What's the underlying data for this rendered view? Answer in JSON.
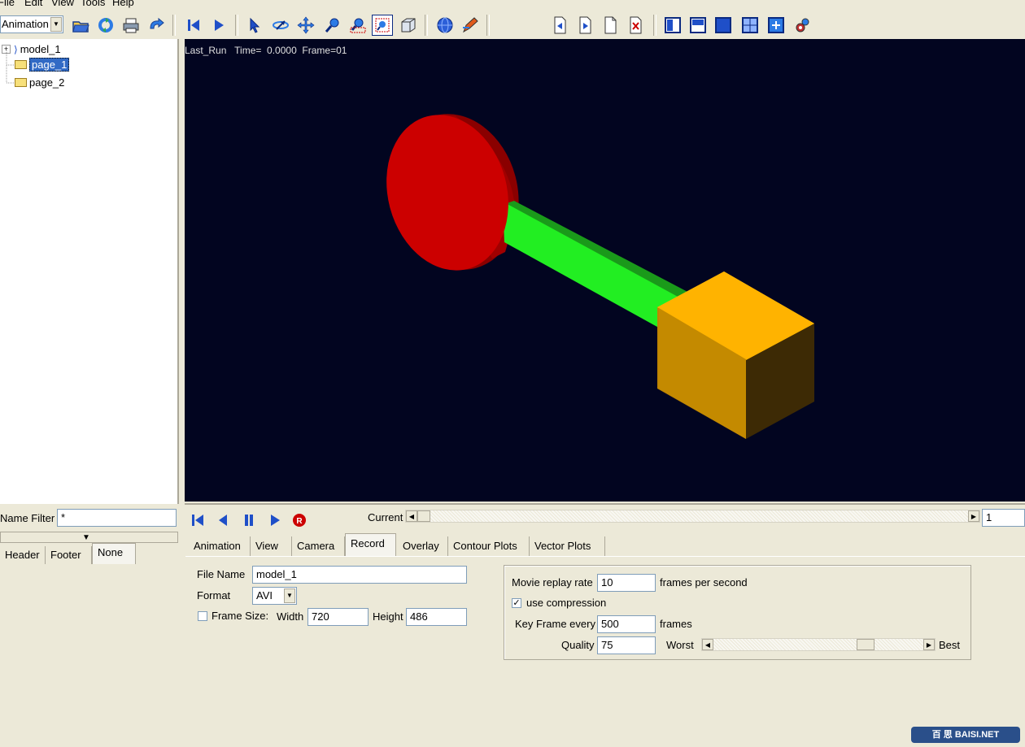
{
  "menu": {
    "items": [
      "File",
      "Edit",
      "View",
      "Tools",
      "Help"
    ]
  },
  "toolbar": {
    "mode": "Animation",
    "icons": [
      "open-folder",
      "reload",
      "print",
      "undo",
      "first-frame",
      "play",
      "select",
      "rotate",
      "translate",
      "zoom",
      "dynamic-zoom",
      "zoom-box",
      "box-view",
      "render",
      "edit",
      "page-prev",
      "page-next",
      "page-new",
      "page-delete",
      "layout-1",
      "layout-2",
      "layout-3",
      "layout-4",
      "layout-5",
      "settings"
    ]
  },
  "tree": {
    "model": "model_1",
    "pages": [
      "page_1",
      "page_2"
    ],
    "selected": "page_1"
  },
  "viewport": {
    "info": "Last_Run   Time=  0.0000  Frame=01",
    "background": "#020520",
    "colors": {
      "disk": "#cc0000",
      "link": "#22ee22",
      "block": "#ffb300"
    }
  },
  "filter": {
    "label": "Name Filter",
    "value": "*"
  },
  "left_tabs": [
    "Header",
    "Footer",
    "None"
  ],
  "animation": {
    "current_label": "Current",
    "frame_value": "1"
  },
  "tabs": [
    "Animation",
    "View",
    "Camera",
    "Record",
    "Overlay",
    "Contour Plots",
    "Vector Plots"
  ],
  "active_tab": "Record",
  "record": {
    "file_name_label": "File Name",
    "file_name": "model_1",
    "format_label": "Format",
    "format": "AVI",
    "frame_size_label": "Frame Size:",
    "width_label": "Width",
    "width": "720",
    "height_label": "Height",
    "height": "486",
    "replay_label": "Movie replay rate",
    "replay_value": "10",
    "replay_unit": "frames per second",
    "compression_label": "use compression",
    "compression_checked": true,
    "keyframe_label": "Key Frame every",
    "keyframe_value": "500",
    "keyframe_unit": "frames",
    "quality_label": "Quality",
    "quality_value": "75",
    "worst_label": "Worst",
    "best_label": "Best"
  },
  "watermark": "百 思  BAISI.NET"
}
